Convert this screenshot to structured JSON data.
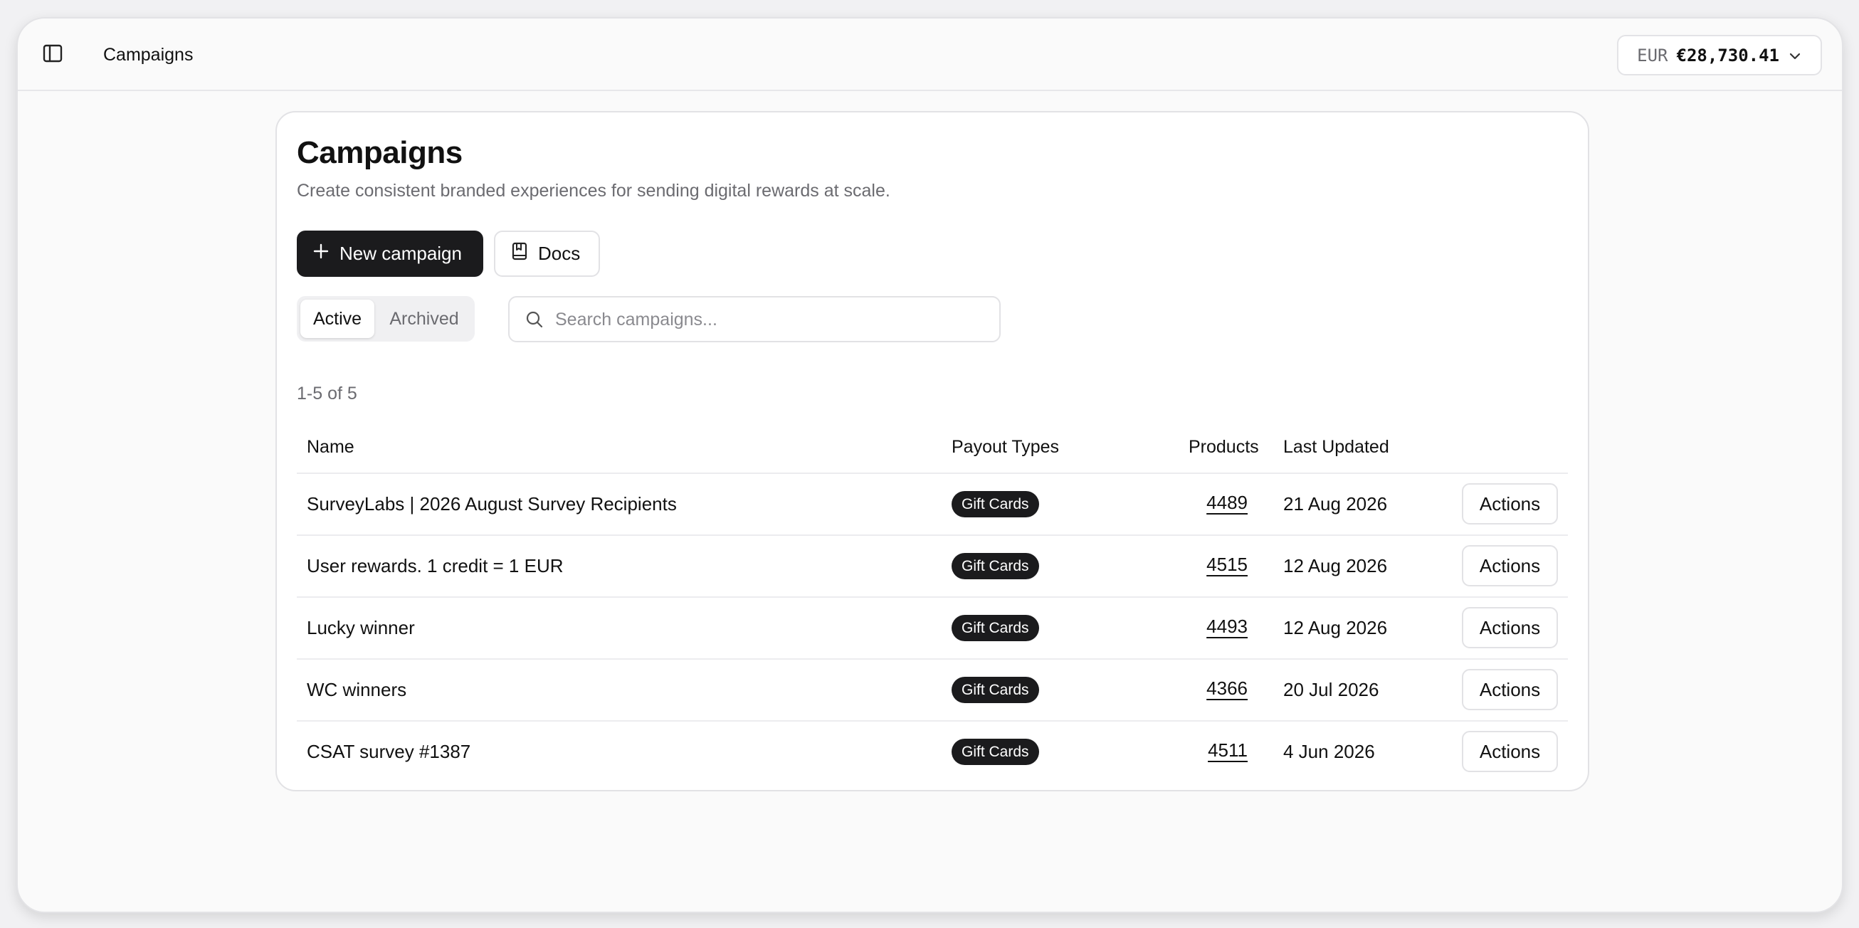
{
  "topbar": {
    "title": "Campaigns",
    "balance_currency": "EUR",
    "balance_amount": "€28,730.41"
  },
  "page": {
    "title": "Campaigns",
    "subtitle": "Create consistent branded experiences for sending digital rewards at scale.",
    "new_campaign_label": "New campaign",
    "docs_label": "Docs",
    "tabs": {
      "active": "Active",
      "archived": "Archived"
    },
    "search_placeholder": "Search campaigns...",
    "count_text": "1-5 of 5"
  },
  "table": {
    "headers": {
      "name": "Name",
      "payout_types": "Payout Types",
      "products": "Products",
      "last_updated": "Last Updated"
    },
    "rows": [
      {
        "name": "SurveyLabs | 2026 August Survey Recipients",
        "payout": "Gift Cards",
        "products": "4489",
        "updated": "21 Aug 2026",
        "action": "Actions"
      },
      {
        "name": "User rewards. 1 credit = 1 EUR",
        "payout": "Gift Cards",
        "products": "4515",
        "updated": "12 Aug 2026",
        "action": "Actions"
      },
      {
        "name": "Lucky winner",
        "payout": "Gift Cards",
        "products": "4493",
        "updated": "12 Aug 2026",
        "action": "Actions"
      },
      {
        "name": "WC winners",
        "payout": "Gift Cards",
        "products": "4366",
        "updated": "20 Jul 2026",
        "action": "Actions"
      },
      {
        "name": "CSAT survey #1387",
        "payout": "Gift Cards",
        "products": "4511",
        "updated": "4 Jun 2026",
        "action": "Actions"
      }
    ]
  },
  "icons": {
    "sidebar_toggle": "sidebar-toggle-icon",
    "balance_dropdown": "chevron-down-icon",
    "new_campaign": "plus-icon",
    "docs": "book-icon",
    "search": "search-icon"
  },
  "colors": {
    "primary_button": "#1b1b1d",
    "badge": "#1b1b1d",
    "muted_text": "#6b6b70"
  }
}
